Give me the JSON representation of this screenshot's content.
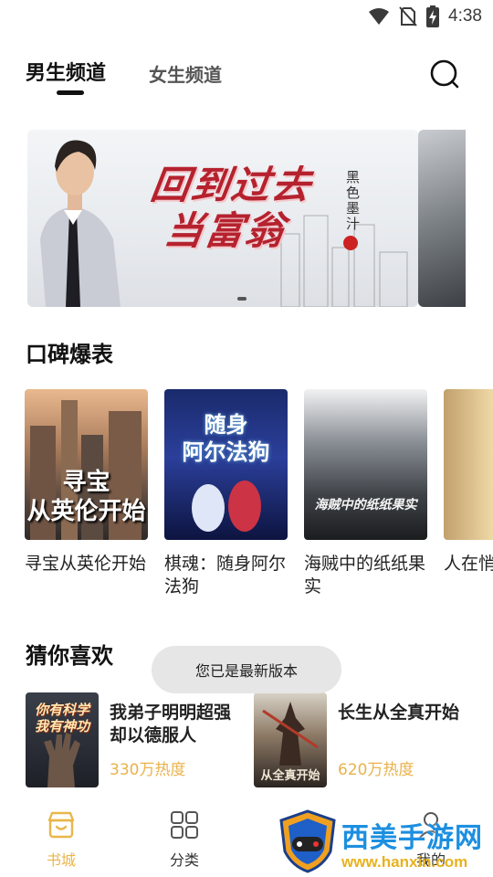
{
  "status_bar": {
    "time": "4:38",
    "icons": [
      "wifi-icon",
      "no-sim-icon",
      "battery-charging-icon"
    ]
  },
  "tabs": [
    {
      "label": "男生频道",
      "active": true
    },
    {
      "label": "女生频道",
      "active": false
    }
  ],
  "search": {
    "icon": "search-icon"
  },
  "banner": {
    "title": "回到过去\n当富翁",
    "author": "黑色墨汁"
  },
  "sections": {
    "praise_title": "口碑爆表",
    "guess_title": "猜你喜欢"
  },
  "books": [
    {
      "title": "寻宝从英伦开始",
      "cover_text": "寻宝\n从英伦开始"
    },
    {
      "title": "棋魂：随身阿尔法狗",
      "cover_text": "随身\n阿尔法狗"
    },
    {
      "title": "海贼中的纸纸果实",
      "cover_text": "海贼中的纸纸果实"
    },
    {
      "title": "人在悄悄",
      "cover_text": ""
    }
  ],
  "guess": [
    {
      "title": "我弟子明明超强却以德服人",
      "heat": "330万热度",
      "cover_text": "你有科学\n我有神功"
    },
    {
      "title": "长生从全真开始",
      "heat": "620万热度",
      "cover_text": "从全真开始"
    }
  ],
  "toast": "您已是最新版本",
  "bottom_nav": [
    {
      "label": "书城",
      "icon": "bookstore-icon",
      "active": true
    },
    {
      "label": "分类",
      "icon": "grid-icon",
      "active": false
    },
    {
      "label": "我的",
      "icon": "profile-icon",
      "active": false
    }
  ],
  "watermark": {
    "text": "西美手游网",
    "url": "www.hanxin.com"
  },
  "colors": {
    "accent": "#e9b64a",
    "heat": "#e9b24b",
    "banner_red": "#b5222e"
  }
}
